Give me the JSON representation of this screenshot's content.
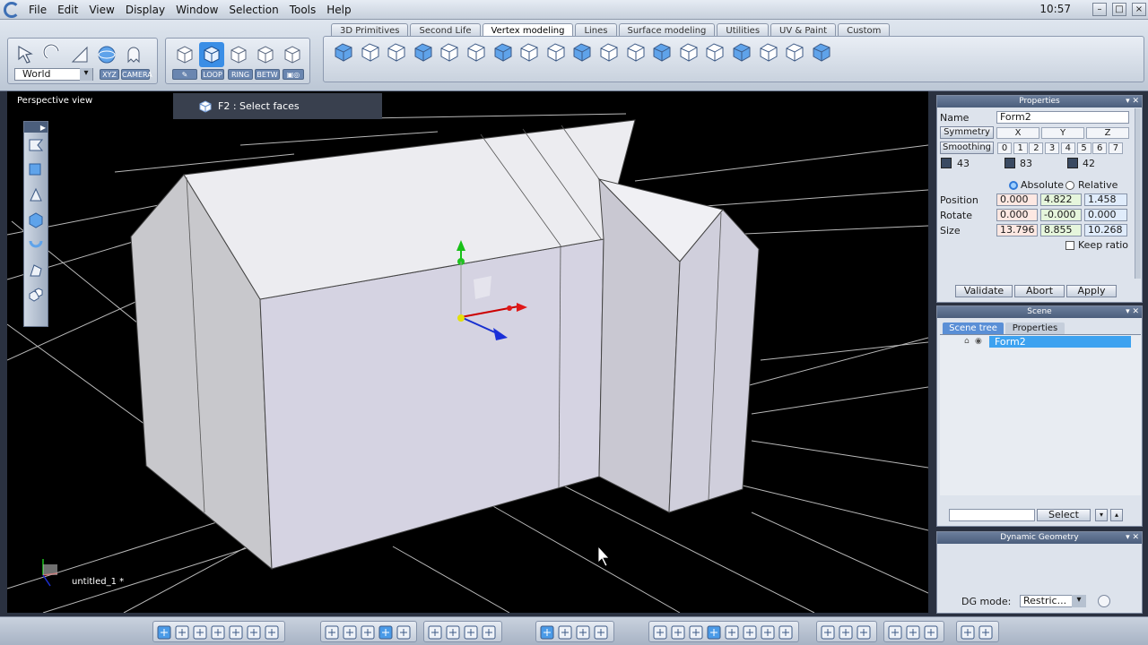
{
  "menubar": {
    "items": [
      "File",
      "Edit",
      "View",
      "Display",
      "Window",
      "Selection",
      "Tools",
      "Help"
    ],
    "clock": "10:57"
  },
  "toolbar": {
    "tabs": [
      "3D Primitives",
      "Second Life",
      "Vertex modeling",
      "Lines",
      "Surface modeling",
      "Utilities",
      "UV & Paint",
      "Custom"
    ],
    "active_tab": "Vertex modeling",
    "coord_space": "World",
    "xyz_label": "XYZ",
    "camera_label": "CAMERA",
    "loop_label": "LOOP",
    "ring_label": "RING",
    "betw_label": "BETW"
  },
  "viewport": {
    "title": "Perspective view",
    "hint": "F2 : Select faces",
    "document": "untitled_1 *"
  },
  "properties": {
    "title": "Properties",
    "name_label": "Name",
    "name_value": "Form2",
    "symmetry_label": "Symmetry",
    "sym_axes": [
      "X",
      "Y",
      "Z"
    ],
    "smoothing_label": "Smoothing",
    "smoothing_levels": [
      "0",
      "1",
      "2",
      "3",
      "4",
      "5",
      "6",
      "7"
    ],
    "counts": [
      "43",
      "83",
      "42"
    ],
    "absolute_label": "Absolute",
    "relative_label": "Relative",
    "position_label": "Position",
    "position": [
      "0.000",
      "4.822",
      "1.458"
    ],
    "rotate_label": "Rotate",
    "rotate": [
      "0.000",
      "-0.000",
      "0.000"
    ],
    "size_label": "Size",
    "size": [
      "13.796",
      "8.855",
      "10.268"
    ],
    "keep_ratio_label": "Keep ratio",
    "validate_label": "Validate",
    "abort_label": "Abort",
    "apply_label": "Apply"
  },
  "scene": {
    "title": "Scene",
    "tab_tree": "Scene tree",
    "tab_properties": "Properties",
    "items": [
      "Form2"
    ],
    "select_label": "Select"
  },
  "dynamic_geometry": {
    "title": "Dynamic Geometry",
    "mode_label": "DG mode:",
    "mode_value": "Restric..."
  },
  "colors": {
    "accent": "#3a8ee6",
    "panel_title": "#5a6d8b",
    "viewport_bg": "#000000"
  }
}
